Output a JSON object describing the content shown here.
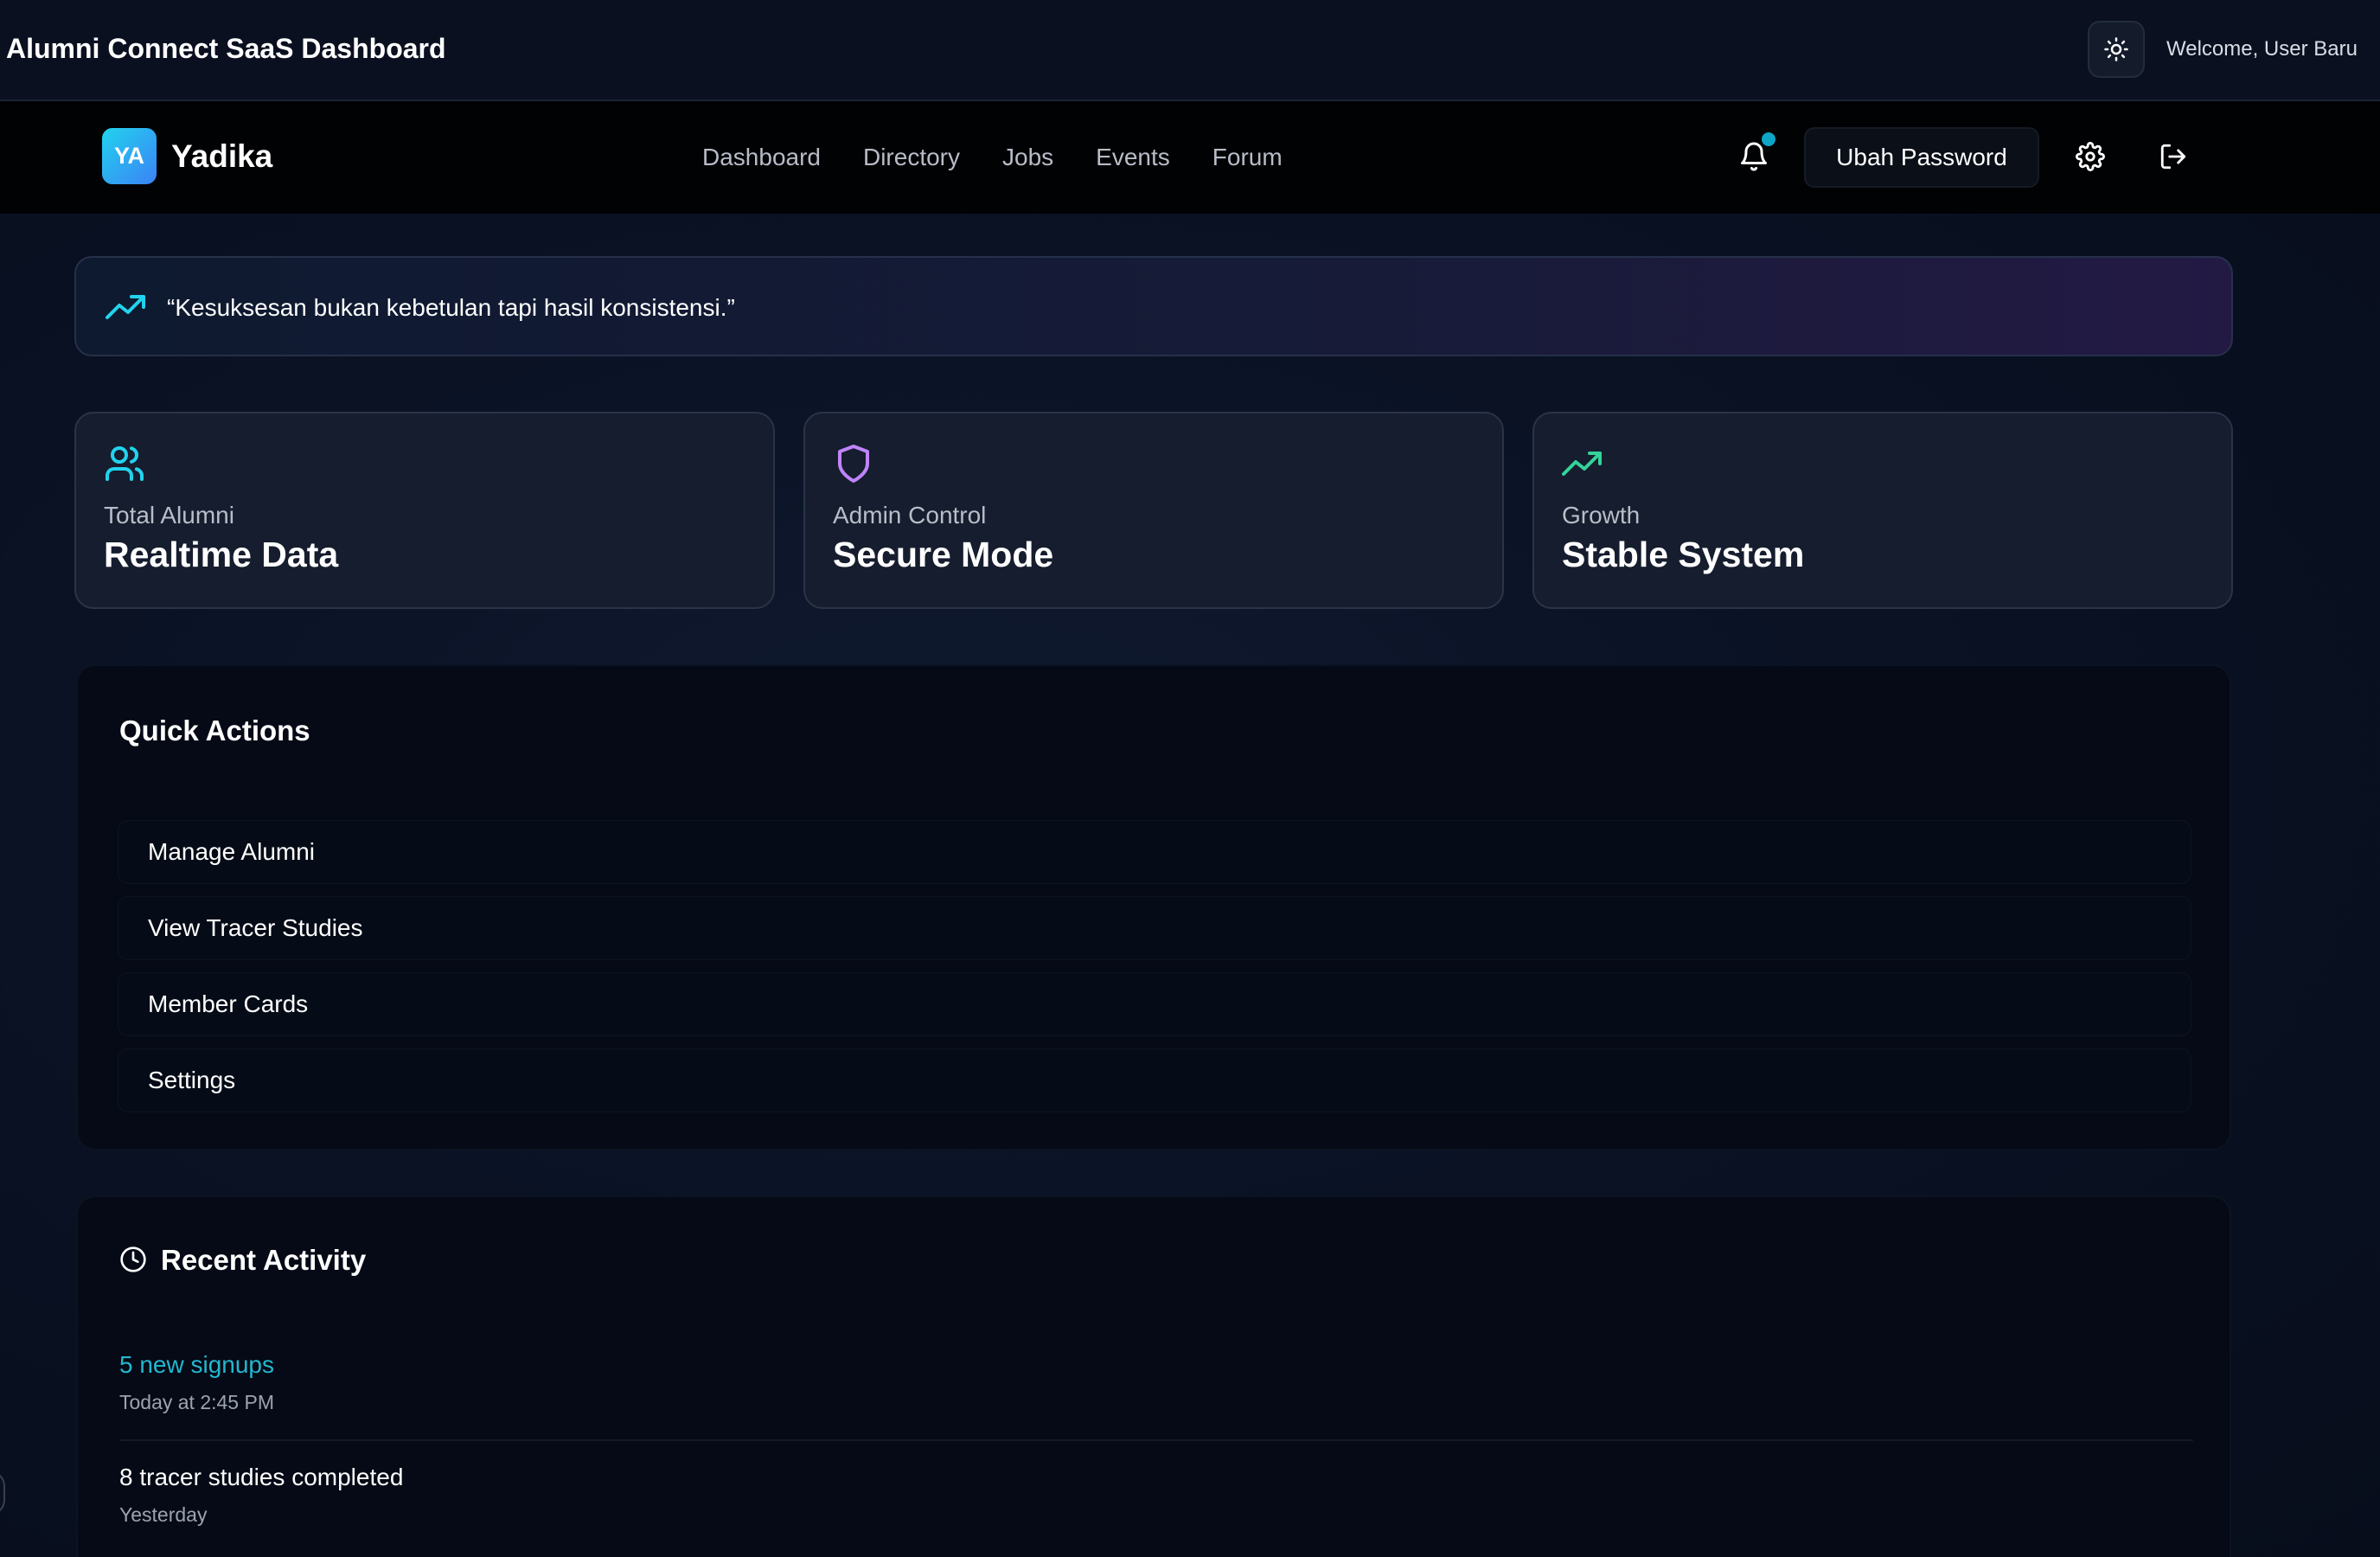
{
  "topbar": {
    "title": "Alumni Connect SaaS Dashboard",
    "theme_icon": "sun-icon",
    "welcome": "Welcome, User Baru"
  },
  "navbar": {
    "logo_initials": "YA",
    "brand": "Yadika",
    "links": [
      "Dashboard",
      "Directory",
      "Jobs",
      "Events",
      "Forum"
    ],
    "notification_icon": "bell-icon",
    "password_button": "Ubah Password",
    "settings_icon": "gear-icon",
    "logout_icon": "logout-icon"
  },
  "quote": {
    "icon": "trending-up-icon",
    "text": "“Kesuksesan bukan kebetulan tapi hasil konsistensi.”"
  },
  "stats": [
    {
      "icon": "users-icon",
      "label": "Total Alumni",
      "value": "Realtime Data",
      "color": "#22d3ee"
    },
    {
      "icon": "shield-icon",
      "label": "Admin Control",
      "value": "Secure Mode",
      "color": "#c084fc"
    },
    {
      "icon": "trending-up-icon",
      "label": "Growth",
      "value": "Stable System",
      "color": "#34d399"
    }
  ],
  "quick_actions": {
    "title": "Quick Actions",
    "items": [
      "Manage Alumni",
      "View Tracer Studies",
      "Member Cards",
      "Settings"
    ]
  },
  "recent_activity": {
    "title": "Recent Activity",
    "icon": "clock-icon",
    "items": [
      {
        "title": "5 new signups",
        "time": "Today at 2:45 PM",
        "color": "#22b8cf"
      },
      {
        "title": "8 tracer studies completed",
        "time": "Yesterday",
        "color": "#ffffff"
      }
    ]
  },
  "colors": {
    "accent_cyan": "#22d3ee",
    "accent_purple": "#c084fc",
    "accent_green": "#34d399",
    "notification_dot": "#0ea5c6"
  }
}
